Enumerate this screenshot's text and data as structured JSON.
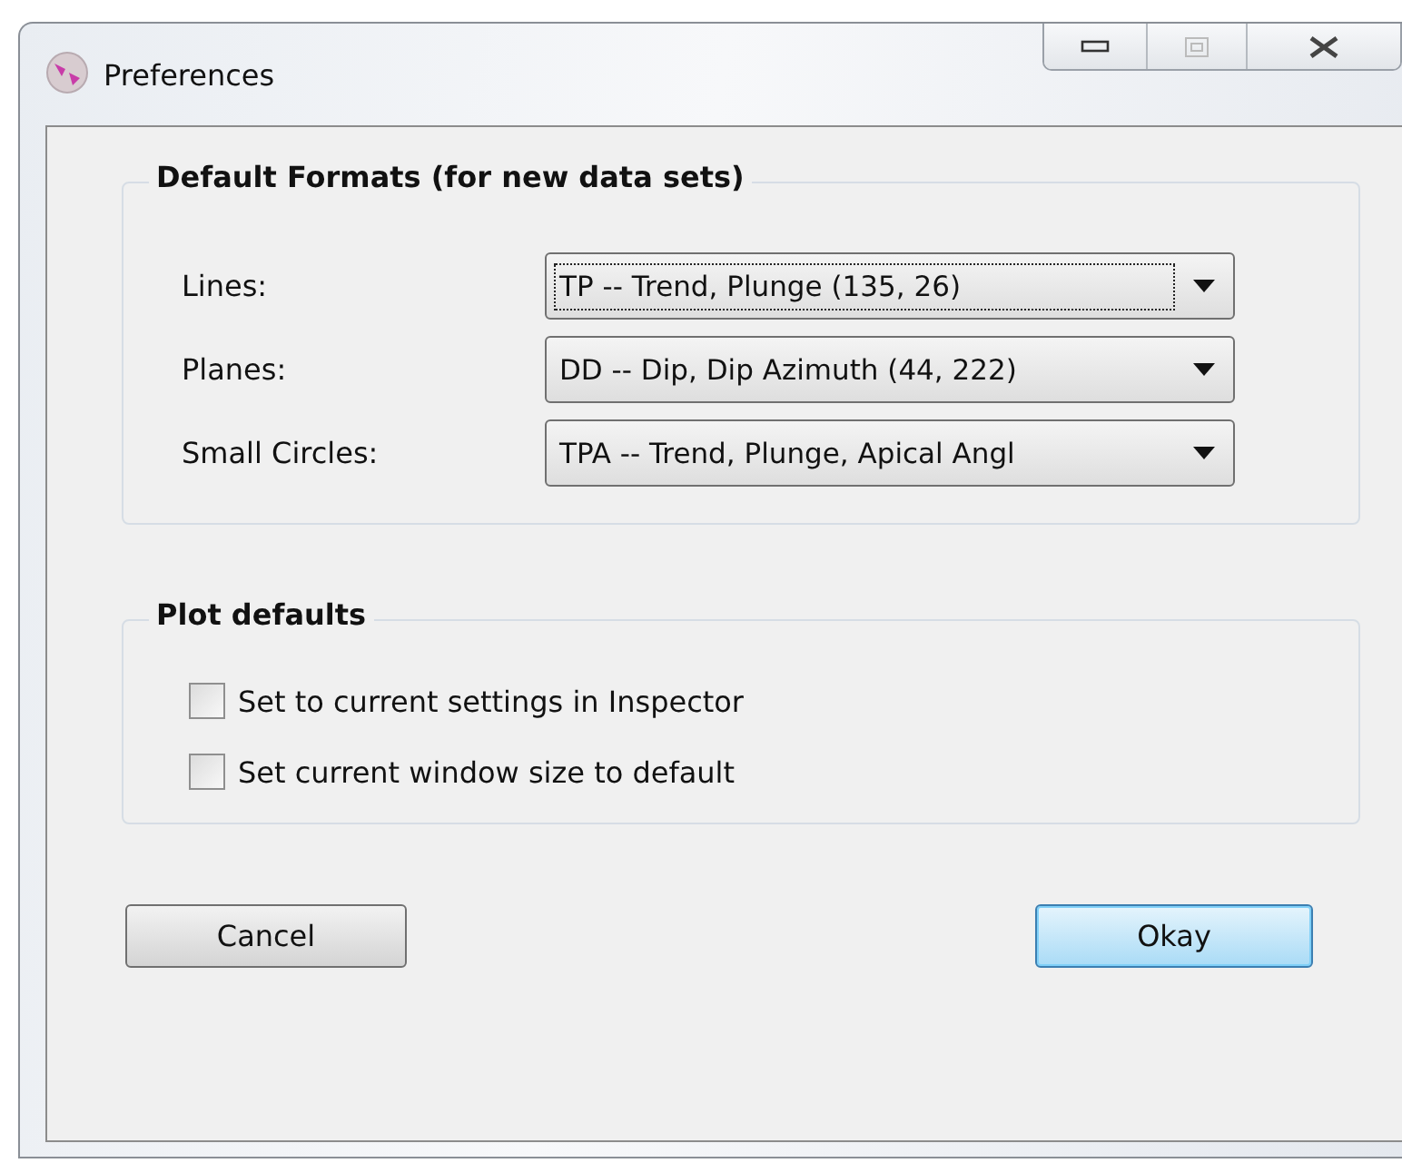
{
  "window": {
    "title": "Preferences"
  },
  "groups": [
    {
      "title": "Default Formats (for new data sets)",
      "kind": "combos",
      "rows": [
        {
          "label": "Lines:",
          "value": "TP -- Trend, Plunge (135, 26)",
          "focused": true
        },
        {
          "label": "Planes:",
          "value": "DD -- Dip, Dip Azimuth (44, 222)",
          "focused": false
        },
        {
          "label": "Small Circles:",
          "value": "TPA -- Trend, Plunge, Apical Angl",
          "focused": false
        }
      ]
    },
    {
      "title": "Plot defaults",
      "kind": "checks",
      "rows": [
        {
          "label": "Set to current settings in Inspector",
          "checked": false
        },
        {
          "label": "Set current window size to default",
          "checked": false
        }
      ]
    }
  ],
  "buttons": [
    {
      "label": "Cancel",
      "default": false
    },
    {
      "label": "Okay",
      "default": true
    }
  ]
}
